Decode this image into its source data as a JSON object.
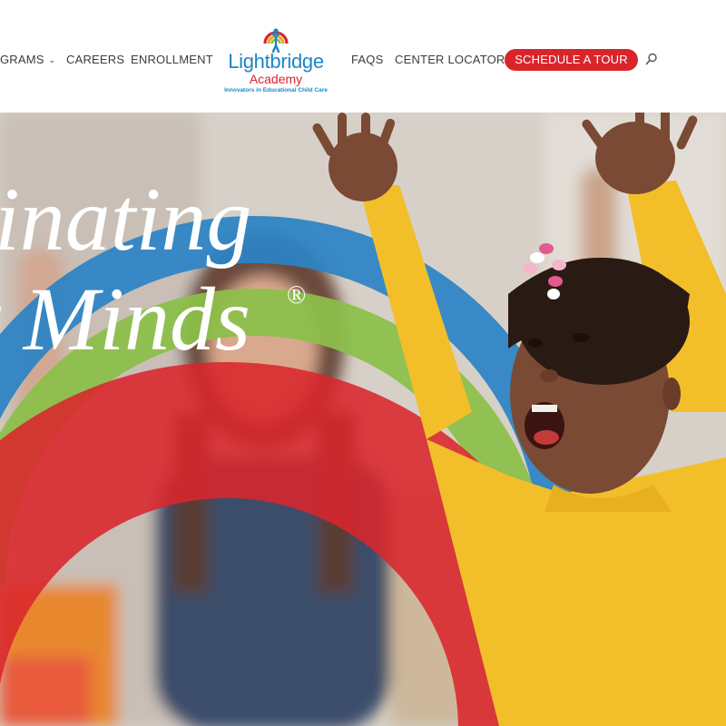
{
  "nav": {
    "programs_label": "GRAMS",
    "careers_label": "CAREERS",
    "enrollment_label": "ENROLLMENT",
    "faqs_label": "FAQS",
    "center_locator_label": "CENTER LOCATOR",
    "tour_button_label": "SCHEDULE A TOUR",
    "search_icon": "search-icon",
    "dropdown_icon": "chevron-down-icon"
  },
  "logo": {
    "name": "Lightbridge",
    "sub": "Academy",
    "tagline": "Innovators in Educational Child Care"
  },
  "hero": {
    "line1": "inating",
    "line2": "Minds",
    "registered": "®"
  },
  "colors": {
    "brand_blue": "#1a86c9",
    "brand_red": "#d9252a",
    "arc_blue": "#2c84c6",
    "arc_green": "#8cc04a",
    "arc_red": "#d9262b",
    "shirt_yellow": "#f2bf2a"
  }
}
